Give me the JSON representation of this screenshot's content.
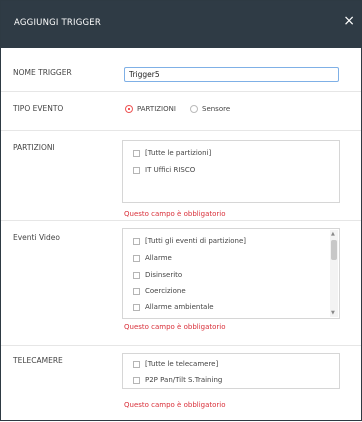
{
  "dialog": {
    "title": "AGGIUNGI TRIGGER",
    "close": "×"
  },
  "trigger_name": {
    "label": "NOME TRIGGER",
    "value": "Trigger5"
  },
  "event_type": {
    "label": "TIPO EVENTO",
    "options": [
      {
        "label": "PARTIZIONI",
        "selected": true
      },
      {
        "label": "Sensore",
        "selected": false
      }
    ]
  },
  "partitions": {
    "label": "PARTIZIONI",
    "items": [
      "[Tutte le partizioni]",
      "IT Uffici RISCO"
    ],
    "error": "Questo campo è obbligatorio"
  },
  "video_events": {
    "label": "Eventi Video",
    "items": [
      "[Tutti gli eventi di partizione]",
      "Allarme",
      "Disinserito",
      "Coercizione",
      "Allarme ambientale"
    ],
    "error": "Questo campo è obbligatorio"
  },
  "cameras": {
    "label": "TELECAMERE",
    "items": [
      "[Tutte le telecamere]",
      "P2P Pan/Tilt S.Training"
    ],
    "error": "Questo campo è obbligatorio"
  },
  "colors": {
    "header": "#2f3b45",
    "error": "#d9303a",
    "focus_border": "#7fb0e6",
    "radio_selected": "#e22222"
  },
  "icons": {
    "close": "close-icon",
    "scroll_up": "chevron-up-icon",
    "scroll_down": "chevron-down-icon"
  }
}
